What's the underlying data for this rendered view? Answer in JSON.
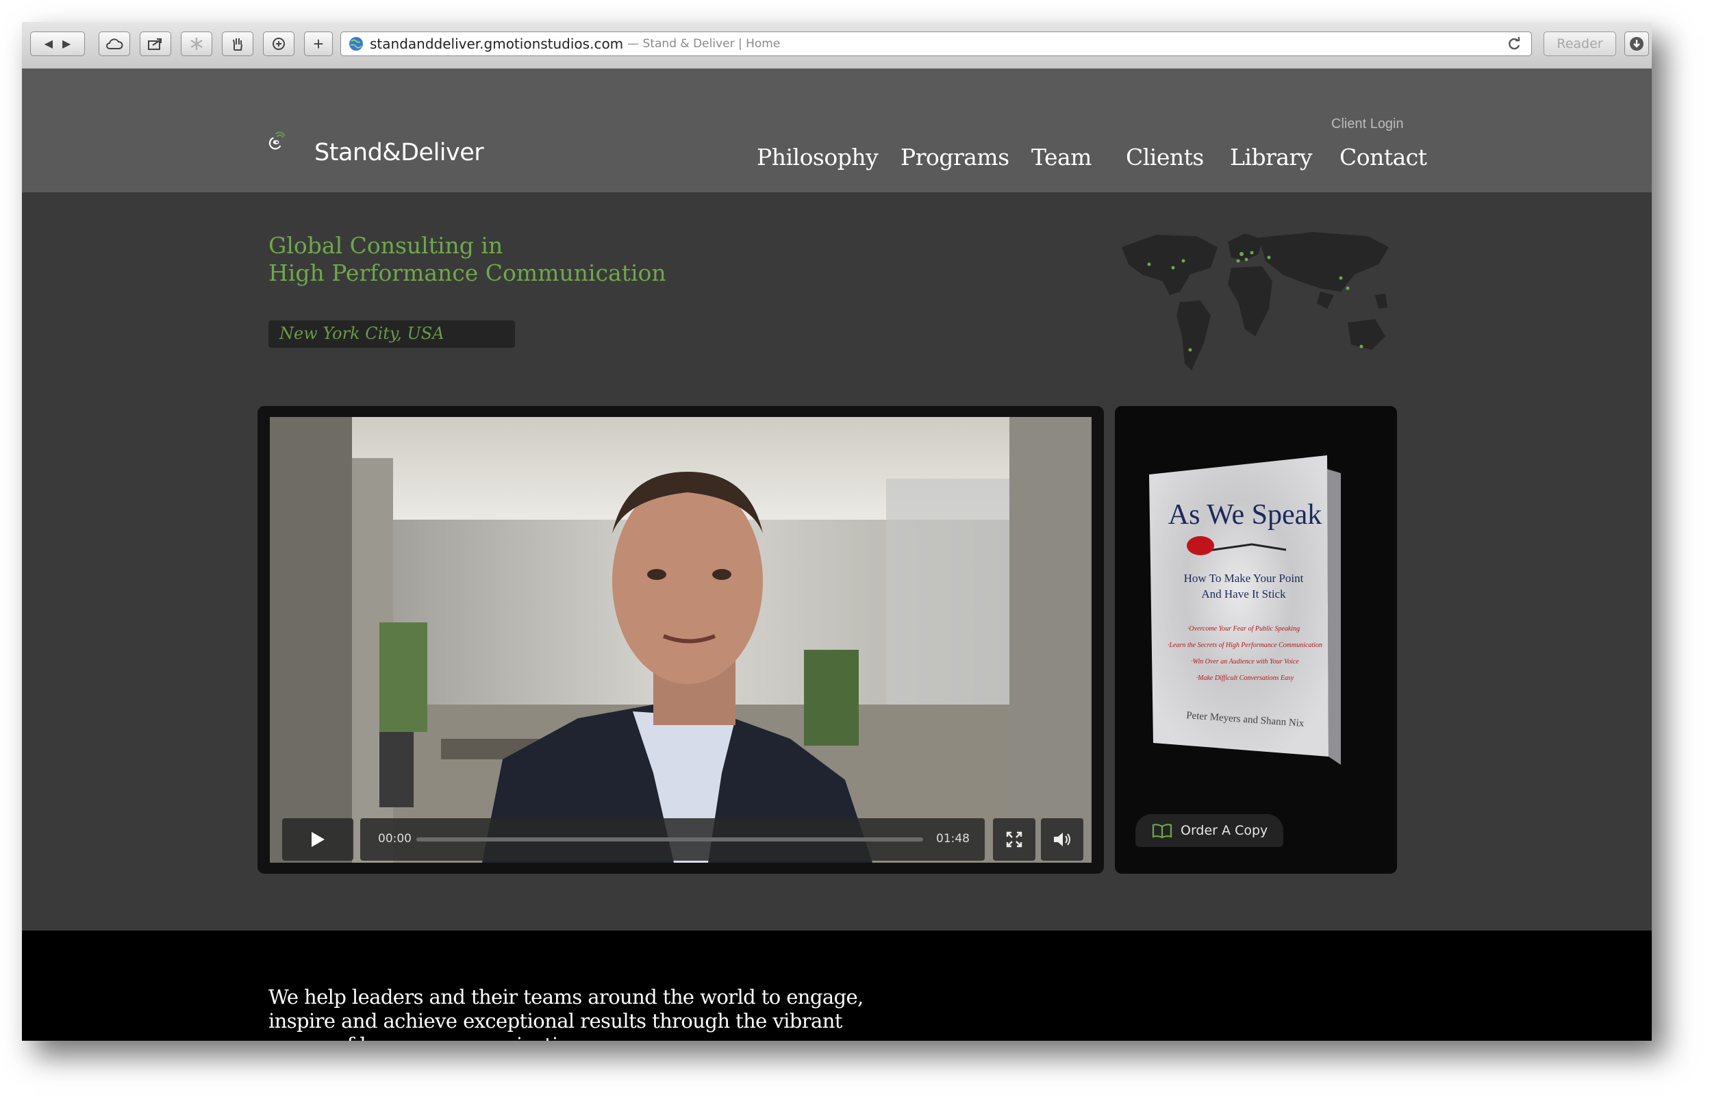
{
  "browser": {
    "url_host": "standanddeliver.gmotionstudios.com",
    "url_title": "— Stand & Deliver | Home",
    "reader_label": "Reader"
  },
  "header": {
    "logo_text": "Stand&Deliver",
    "client_login": "Client Login",
    "nav": [
      "Philosophy",
      "Programs",
      "Team",
      "Clients",
      "Library",
      "Contact"
    ]
  },
  "hero": {
    "tagline_line1": "Global Consulting in",
    "tagline_line2": "High Performance Communication",
    "location": "New York City, USA"
  },
  "video": {
    "time_current": "00:00",
    "time_total": "01:48"
  },
  "book": {
    "title": "As We Speak",
    "subtitle_line1": "How To Make Your Point",
    "subtitle_line2": "And Have It Stick",
    "bullets": [
      "·Overcome Your Fear of Public Speaking",
      "·Learn the Secrets of High Performance Communication",
      "·Win Over an Audience with Your Voice",
      "·Make Difficult Conversations Easy"
    ],
    "authors": "Peter Meyers and Shann Nix",
    "order_label": "Order A Copy"
  },
  "mission": {
    "line1": "We help leaders and their teams around the world to engage,",
    "line2": "inspire and achieve exceptional results through the vibrant",
    "line3": "power of human communication."
  },
  "colors": {
    "accent_green": "#6fa84a",
    "header_gray": "#5a5a5a",
    "body_gray": "#3a3a3a"
  }
}
